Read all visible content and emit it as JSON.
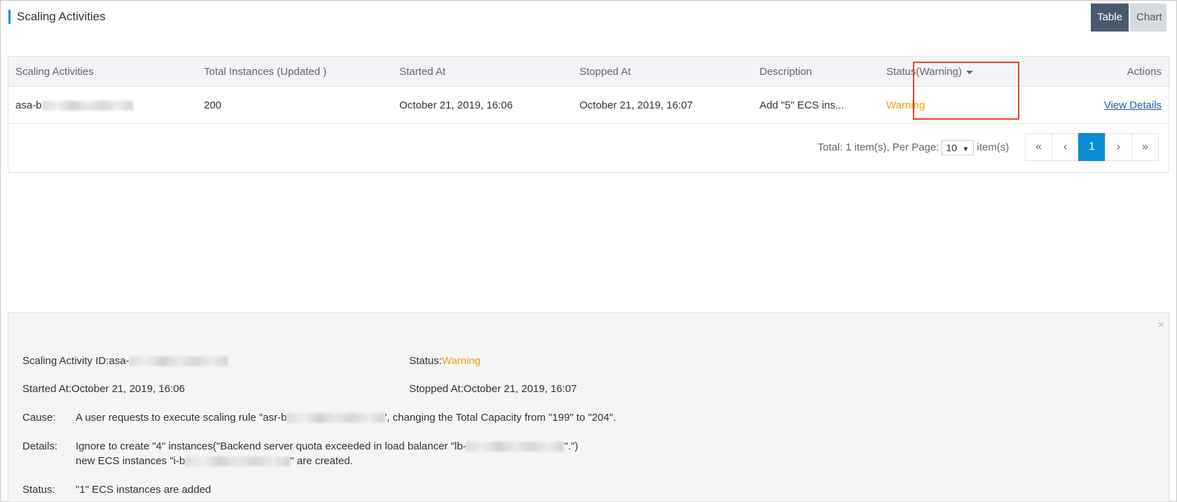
{
  "header": {
    "title": "Scaling Activities",
    "view_buttons": {
      "table": "Table",
      "chart": "Chart"
    }
  },
  "table": {
    "columns": [
      "Scaling Activities",
      "Total Instances (Updated )",
      "Started At",
      "Stopped At",
      "Description",
      "Status(Warning)",
      "Actions"
    ],
    "rows": [
      {
        "activity_prefix": "asa-b",
        "total_instances": "200",
        "started_at": "October 21, 2019, 16:06",
        "stopped_at": "October 21, 2019, 16:07",
        "description": "Add \"5\" ECS ins...",
        "status": "Warning",
        "action": "View Details"
      }
    ]
  },
  "pagination": {
    "total_text": "Total: 1 item(s), Per Page:",
    "per_page": "10",
    "per_page_suffix": "item(s)",
    "first": "«",
    "prev": "‹",
    "current_page": "1",
    "next": "›",
    "last": "»"
  },
  "details": {
    "activity_id_label": "Scaling Activity ID:",
    "activity_id_prefix": "asa-",
    "status_label": "Status:",
    "status_value": "Warning",
    "started_label": "Started At:",
    "started_value": "October 21, 2019, 16:06",
    "stopped_label": "Stopped At:",
    "stopped_value": "October 21, 2019, 16:07",
    "cause_label": "Cause:",
    "cause_text_1": "A user requests to execute scaling rule \"asr-b",
    "cause_text_2": "', changing the Total Capacity from \"199\" to \"204\".",
    "details_label": "Details:",
    "details_line1_a": "Ignore to create \"4\" instances(\"Backend server quota exceeded in load balancer \"lb-",
    "details_line1_b": "\".\")",
    "details_line2_a": "new ECS instances \"i-b",
    "details_line2_b": "\" are created.",
    "status2_label": "Status:",
    "status2_value": "\"1\" ECS instances are added",
    "close_icon": "×"
  },
  "colors": {
    "accent": "#0b8ed4",
    "warning": "#f39b12",
    "highlight": "#e8442c",
    "table_btn": "#4b596e"
  }
}
